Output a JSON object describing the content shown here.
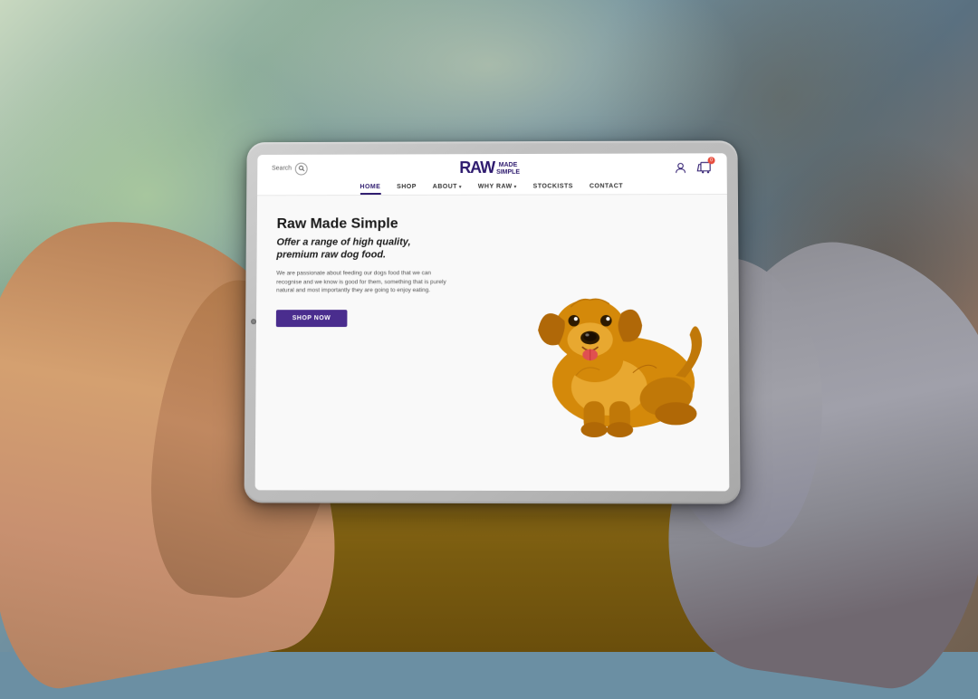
{
  "scene": {
    "background": "living room blur bokeh"
  },
  "tablet": {
    "camera_dot": true
  },
  "website": {
    "header": {
      "search_label": "Search",
      "search_placeholder": "Search...",
      "logo": {
        "raw": "RAW",
        "made": "MADE",
        "simple": "SIMPLE"
      },
      "icons": {
        "account_label": "account",
        "cart_label": "cart",
        "cart_count": "0"
      }
    },
    "nav": {
      "items": [
        {
          "label": "HOME",
          "active": true
        },
        {
          "label": "SHOP",
          "active": false
        },
        {
          "label": "ABOUT",
          "active": false,
          "has_dropdown": true
        },
        {
          "label": "WHY RAW",
          "active": false,
          "has_dropdown": true
        },
        {
          "label": "STOCKISTS",
          "active": false
        },
        {
          "label": "CONTACT",
          "active": false
        }
      ]
    },
    "hero": {
      "title": "Raw Made Simple",
      "subtitle": "Offer a range of high quality,\npremium raw dog food.",
      "description": "We are passionate about feeding our dogs food that we can recognise and we know is good for them, something that is purely natural and most importantly they are going to enjoy eating.",
      "cta_button": "SHOP NOW"
    }
  }
}
